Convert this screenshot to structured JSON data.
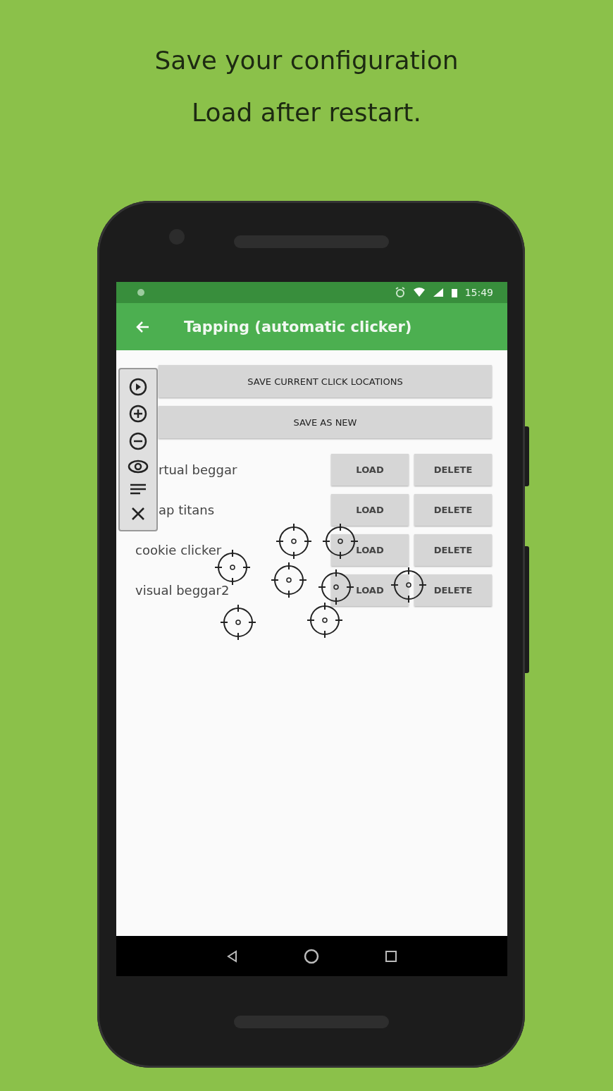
{
  "headline": [
    "Save your configuration",
    "Load after restart."
  ],
  "status_bar": {
    "time": "15:49"
  },
  "app_bar": {
    "title": "Tapping (automatic clicker)"
  },
  "actions": [
    "SAVE CURRENT CLICK LOCATIONS",
    "SAVE AS NEW"
  ],
  "configs": [
    {
      "name": "rtual beggar",
      "load": "LOAD",
      "delete": "DELETE"
    },
    {
      "name": "ap titans",
      "load": "LOAD",
      "delete": "DELETE"
    },
    {
      "name": "cookie clicker",
      "load": "LOAD",
      "delete": "DELETE"
    },
    {
      "name": "visual beggar2",
      "load": "LOAD",
      "delete": "DELETE"
    }
  ]
}
